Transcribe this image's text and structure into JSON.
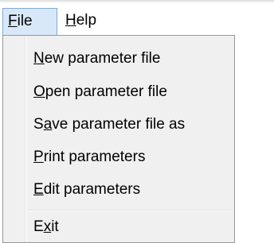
{
  "menubar": {
    "file": {
      "mnemonic": "F",
      "rest": "ile"
    },
    "help": {
      "mnemonic": "H",
      "rest": "elp"
    }
  },
  "file_menu": {
    "items": [
      {
        "mnemonic": "N",
        "rest": "ew parameter file"
      },
      {
        "mnemonic": "O",
        "rest": "pen parameter file"
      },
      {
        "pre": "S",
        "mnemonic": "a",
        "rest": "ve parameter file as"
      },
      {
        "mnemonic": "P",
        "rest": "rint parameters"
      },
      {
        "mnemonic": "E",
        "rest": "dit parameters"
      },
      {
        "pre": "E",
        "mnemonic": "x",
        "rest": "it"
      }
    ]
  },
  "colors": {
    "active_title_bg": "#d9e8f8",
    "active_title_border": "#7fa8d6",
    "menu_bg": "#f0f0f0",
    "menu_border": "#979797"
  }
}
